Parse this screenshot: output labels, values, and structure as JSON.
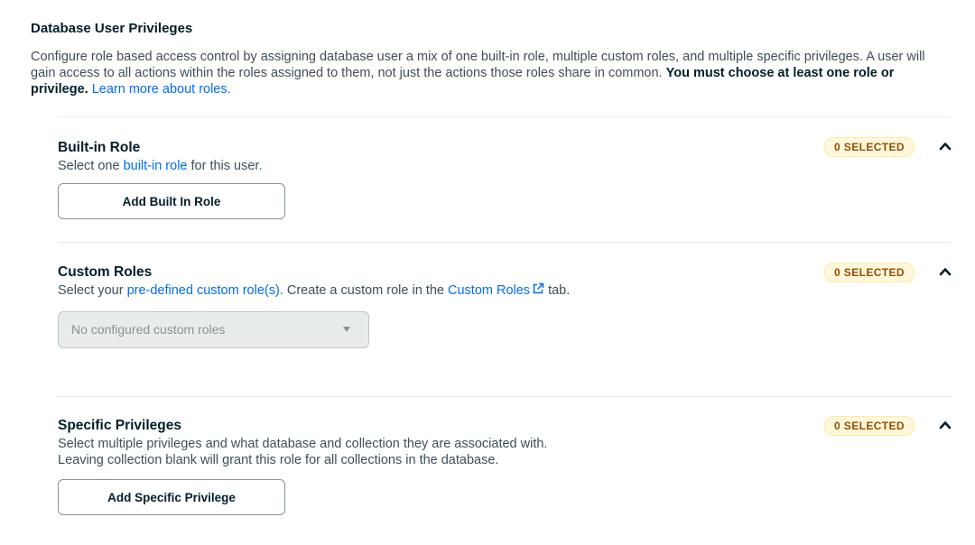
{
  "header": {
    "title": "Database User Privileges",
    "intro_text": "Configure role based access control by assigning database user a mix of one built-in role, multiple custom roles, and multiple specific privileges. A user will gain access to all actions within the roles assigned to them, not just the actions those roles share in common. ",
    "intro_bold": "You must choose at least one role or privilege.",
    "learn_more_link": "Learn more about roles."
  },
  "built_in_role": {
    "title": "Built-in Role",
    "desc_prefix": "Select one ",
    "desc_link": "built-in role",
    "desc_suffix": " for this user.",
    "badge": "0 SELECTED",
    "button_label": "Add Built In Role"
  },
  "custom_roles": {
    "title": "Custom Roles",
    "desc_prefix": "Select your ",
    "desc_link": "pre-defined custom role(s)",
    "desc_middle": ". Create a custom role in the ",
    "desc_link2": "Custom Roles",
    "desc_suffix": " tab.",
    "badge": "0 SELECTED",
    "select_placeholder": "No configured custom roles"
  },
  "specific_privileges": {
    "title": "Specific Privileges",
    "desc_line1": "Select multiple privileges and what database and collection they are associated with.",
    "desc_line2": "Leaving collection blank will grant this role for all collections in the database.",
    "badge": "0 SELECTED",
    "button_label": "Add Specific Privilege"
  },
  "icons": {
    "collapse": "chevron-up-icon",
    "external_link": "external-link-icon",
    "dropdown": "caret-down-icon"
  },
  "colors": {
    "link": "#016bf8",
    "badge_bg": "#fef7db",
    "badge_text": "#944f01",
    "disabled_bg": "#e8edeb"
  }
}
